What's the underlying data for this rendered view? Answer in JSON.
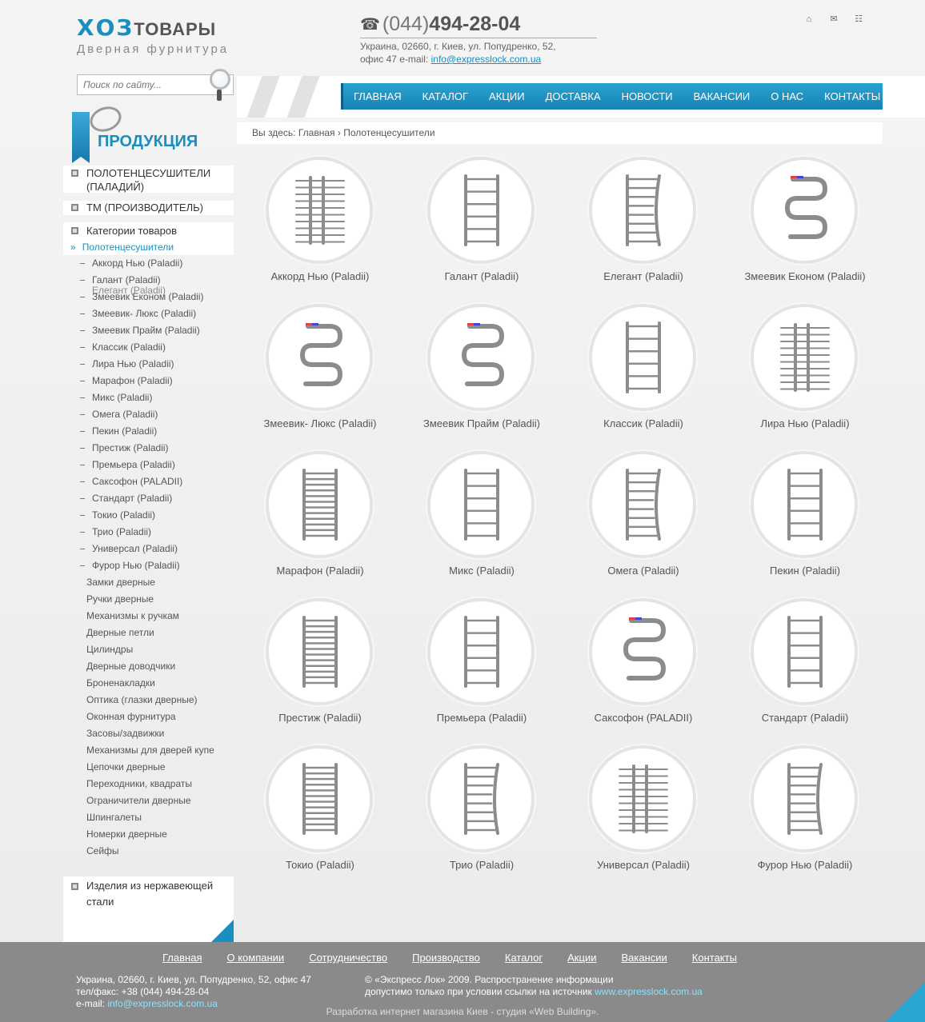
{
  "header": {
    "logo_main": "ХОЗ",
    "logo_tail": "ТОВАРЫ",
    "logo_sub": "Дверная фурнитура",
    "phone_code": "(044)",
    "phone_number": "494-28-04",
    "address_line1": "Украина, 02660, г. Киев, ул. Попудренко, 52,",
    "address_line2": "офис 47 e-mail: ",
    "email": "info@expresslock.com.ua",
    "icons": [
      "home-icon",
      "mail-icon",
      "sitemap-icon"
    ]
  },
  "search": {
    "placeholder": "Поиск по сайту..."
  },
  "nav": [
    "ГЛАВНАЯ",
    "КАТАЛОГ",
    "АКЦИИ",
    "ДОСТАВКА",
    "НОВОСТИ",
    "ВАКАНСИИ",
    "О НАС",
    "КОНТАКТЫ"
  ],
  "sidebar": {
    "title": "ПРОДУКЦИЯ",
    "block1": "ПОЛОТЕНЦЕСУШИТЕЛИ (ПАЛАДИЙ)",
    "block2": "ТМ (ПРОИЗВОДИТЕЛЬ)",
    "block3": "Категории товаров",
    "active": "Полотенцесушители",
    "ghost": "Елегант (Paladii)",
    "sub_items": [
      "Аккорд Нью (Paladii)",
      "Галант (Paladii)",
      "Змеевик Економ (Paladii)",
      "Змеевик- Люкс (Paladii)",
      "Змеевик Прайм (Paladii)",
      "Классик (Paladii)",
      "Лира Нью (Paladii)",
      "Марафон (Paladii)",
      "Микс (Paladii)",
      "Омега (Paladii)",
      "Пекин (Paladii)",
      "Престиж (Paladii)",
      "Премьера (Paladii)",
      "Саксофон (PALADII)",
      "Стандарт (Paladii)",
      "Токио (Paladii)",
      "Трио (Paladii)",
      "Универсал (Paladii)",
      "Фурор Нью (Paladii)"
    ],
    "categories": [
      "Замки дверные",
      "Ручки дверные",
      "Механизмы к ручкам",
      "Дверные петли",
      "Цилиндры",
      "Дверные доводчики",
      "Броненакладки",
      "Оптика (глазки дверные)",
      "Оконная фурнитура",
      "Засовы/задвижки",
      "Механизмы для дверей купе",
      "Цепочки дверные",
      "Переходники, квадраты",
      "Ограничители дверные",
      "Шпингалеты",
      "Номерки дверные",
      "Сейфы"
    ],
    "block4": "Изделия из нержавеющей стали"
  },
  "breadcrumb": {
    "prefix": "Вы здесь:",
    "home": "Главная",
    "separator": "›",
    "current": "Полотенцесушители"
  },
  "products": [
    {
      "name": "Аккорд Нью (Paladii)",
      "shape": "accord"
    },
    {
      "name": "Галант (Paladii)",
      "shape": "ladder"
    },
    {
      "name": "Елегант (Paladii)",
      "shape": "curved"
    },
    {
      "name": "Змеевик Економ (Paladii)",
      "shape": "snake"
    },
    {
      "name": "Змеевик- Люкс (Paladii)",
      "shape": "snake"
    },
    {
      "name": "Змеевик Прайм (Paladii)",
      "shape": "snake"
    },
    {
      "name": "Классик (Paladii)",
      "shape": "ladder"
    },
    {
      "name": "Лира Нью (Paladii)",
      "shape": "accord"
    },
    {
      "name": "Марафон (Paladii)",
      "shape": "dense"
    },
    {
      "name": "Микс (Paladii)",
      "shape": "ladder"
    },
    {
      "name": "Омега (Paladii)",
      "shape": "curved"
    },
    {
      "name": "Пекин (Paladii)",
      "shape": "ladder"
    },
    {
      "name": "Престиж (Paladii)",
      "shape": "dense"
    },
    {
      "name": "Премьера (Paladii)",
      "shape": "ladder"
    },
    {
      "name": "Саксофон (PALADII)",
      "shape": "snake"
    },
    {
      "name": "Стандарт (Paladii)",
      "shape": "ladder"
    },
    {
      "name": "Токио (Paladii)",
      "shape": "dense"
    },
    {
      "name": "Трио (Paladii)",
      "shape": "curved"
    },
    {
      "name": "Универсал (Paladii)",
      "shape": "accord"
    },
    {
      "name": "Фурор Нью (Paladii)",
      "shape": "curved"
    }
  ],
  "footer": {
    "nav": [
      "Главная",
      "О компании",
      "Сотрудничество",
      "Производство",
      "Каталог",
      "Акции",
      "Вакансии",
      "Контакты"
    ],
    "address": "Украина, 02660, г. Киев, ул. Попудренко, 52, офис 47",
    "phone": "тел/факс: +38 (044) 494-28-04",
    "email_label": "e-mail: ",
    "email": "info@expresslock.com.ua",
    "copyright1": "© «Экспресс Лок» 2009. Распространение информации",
    "copyright2": "допустимо только при условии ссылки на источник ",
    "site": "www.expresslock.com.ua",
    "developer": "Разработка интернет магазина Киев - студия «Web Building»."
  },
  "colors": {
    "accent": "#1a8fbf",
    "nav": "#1683b4",
    "footer": "#8a8a8a"
  }
}
